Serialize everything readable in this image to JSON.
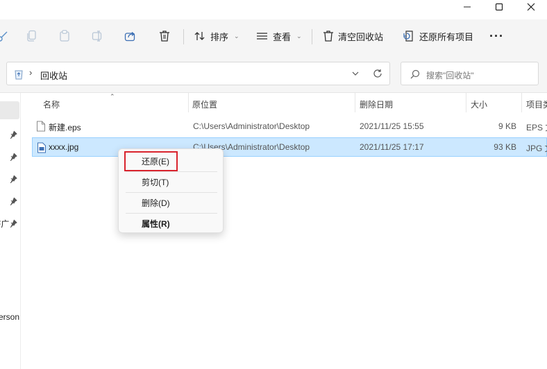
{
  "window": {
    "controls": [
      "minimize",
      "maximize",
      "close"
    ]
  },
  "toolbar": {
    "sort_label": "排序",
    "view_label": "查看",
    "empty_label": "清空回收站",
    "restore_all_label": "还原所有项目",
    "more_label": "···"
  },
  "address": {
    "crumb": "回收站",
    "search_placeholder": "搜索\"回收站\""
  },
  "nav": {
    "partial_label_1": "F广",
    "partial_label_2": "erson"
  },
  "columns": {
    "name": "名称",
    "location": "原位置",
    "deleted": "删除日期",
    "size": "大小",
    "type": "项目类"
  },
  "files": [
    {
      "name": "新建.eps",
      "location": "C:\\Users\\Administrator\\Desktop",
      "deleted": "2021/11/25 15:55",
      "size": "9 KB",
      "type": "EPS 文"
    },
    {
      "name": "xxxx.jpg",
      "location": "C:\\Users\\Administrator\\Desktop",
      "deleted": "2021/11/25 17:17",
      "size": "93 KB",
      "type": "JPG 文"
    }
  ],
  "context_menu": {
    "restore": "还原(E)",
    "cut": "剪切(T)",
    "delete": "删除(D)",
    "properties": "属性(R)"
  },
  "colors": {
    "selection_bg": "#cce8ff",
    "selection_border": "#99d1ff",
    "highlight_box": "#d9232d",
    "toolbar_bg": "#f5f5f5"
  }
}
